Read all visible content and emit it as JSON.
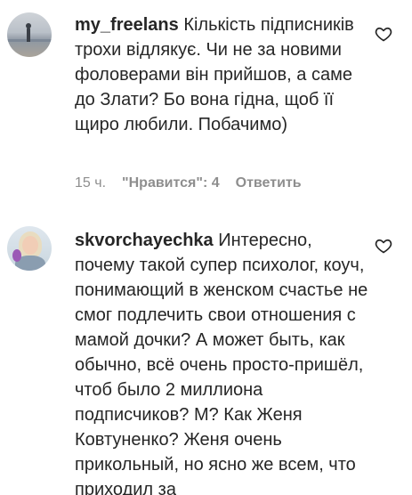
{
  "comments": [
    {
      "username": "my_freelans",
      "text": "Кількість підписників трохи відлякує. Чи не за новими фоловерами він прийшов, а саме до Злати? Бо вона гідна, щоб її щиро любили. Побачимо)",
      "time": "15 ч.",
      "likes": "\"Нравится\": 4",
      "reply": "Ответить"
    },
    {
      "username": "skvorchayechka",
      "text": "Интересно, почему такой супер психолог, коуч, понимающий в женском счастье не смог подлечить свои отношения с мамой дочки? А может быть, как обычно, всё очень просто-пришёл, чтоб было 2 миллиона подписчиков? М? Как Женя Ковтуненко? Женя очень прикольный, но ясно же всем, что приходил за"
    }
  ],
  "icons": {
    "like": "heart-outline-icon"
  }
}
